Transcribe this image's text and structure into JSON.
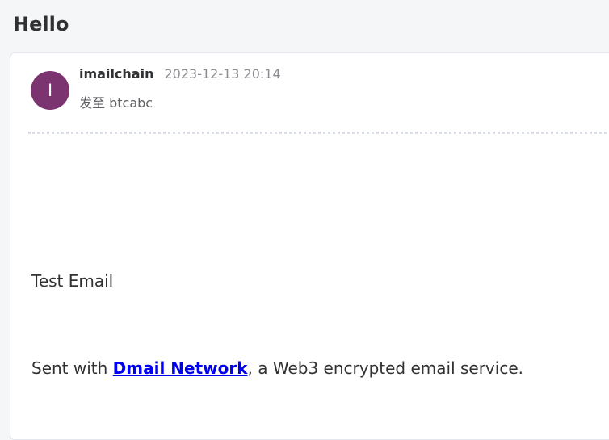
{
  "email": {
    "subject": "Hello",
    "sender": {
      "avatar_letter": "I",
      "name": "imailchain",
      "time": "2023-12-13 20:14"
    },
    "recipient": {
      "prefix": "发至",
      "name": "btcabc"
    },
    "body": {
      "line1": "Test Email",
      "line2_prefix": "Sent with ",
      "link_text": "Dmail Network",
      "line2_suffix": ", a Web3 encrypted email service."
    }
  },
  "colors": {
    "avatar_bg": "#7b3470",
    "link": "#0000ee",
    "page_bg": "#f5f6f8"
  }
}
